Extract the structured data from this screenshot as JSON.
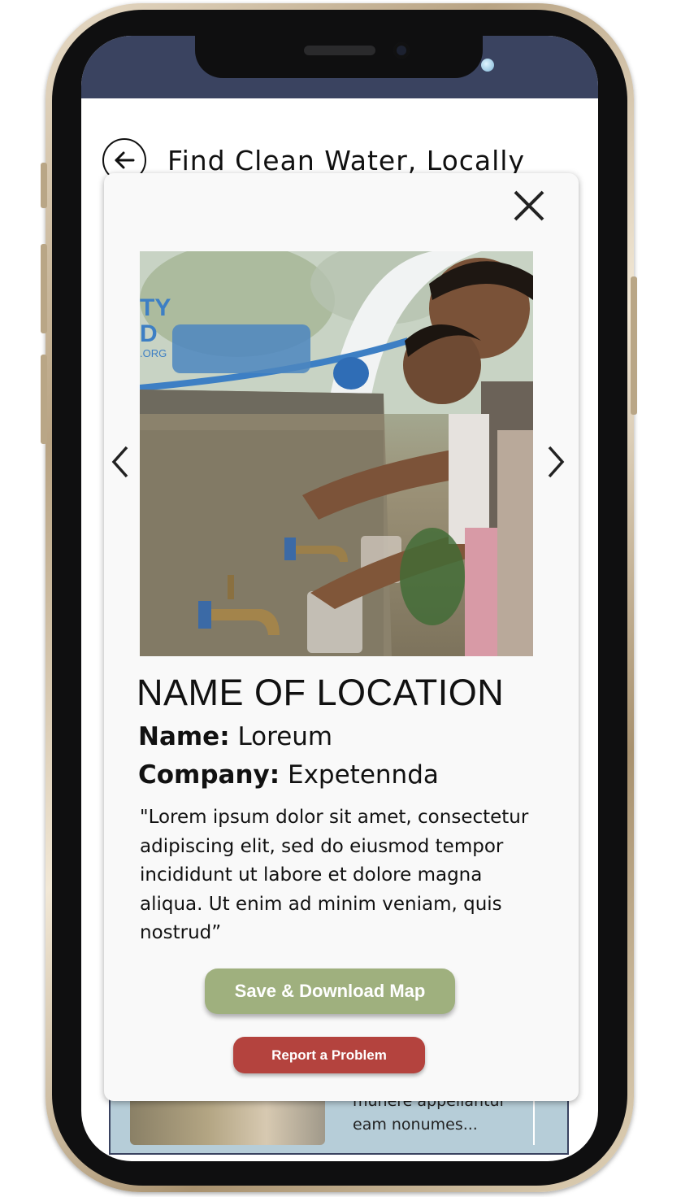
{
  "header": {
    "title": "Find Clean Water, Locally"
  },
  "location": {
    "title": "NAME OF LOCATION",
    "name_label": "Name:",
    "name_value": "Loreum",
    "company_label": "Company:",
    "company_value": "Expetennda",
    "description": "\"Lorem ipsum dolor sit amet, consectetur adipiscing elit, sed do eiusmod tempor incididunt ut labore et dolore magna  aliqua. Ut enim ad minim veniam, quis nostrud”"
  },
  "photo": {
    "watermark_lines": [
      "TY",
      "D",
      ".ORG"
    ]
  },
  "actions": {
    "save_label": "Save & Download Map",
    "report_label": "Report a Problem"
  },
  "background_list": {
    "snippet": "munere appellantur eam nonumes..."
  },
  "icons": {
    "back": "arrow-left-circle-icon",
    "close": "close-icon",
    "prev": "chevron-left-icon",
    "next": "chevron-right-icon"
  },
  "colors": {
    "status_bar": "#3a4360",
    "save_button": "#9fb07e",
    "report_button": "#b4433e",
    "list_card": "#b6cdd8",
    "phone_frame": "#c9b796"
  }
}
